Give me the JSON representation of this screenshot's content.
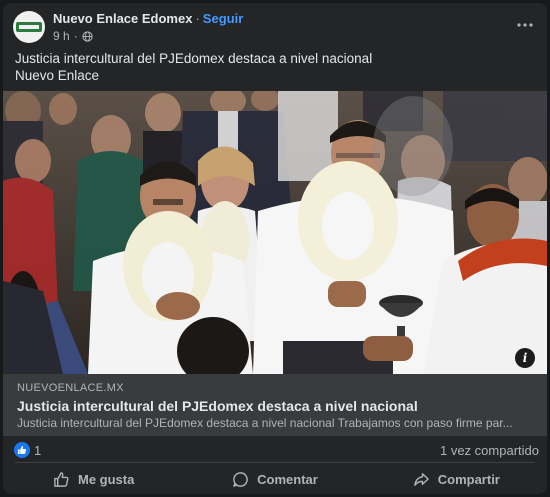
{
  "post": {
    "page_name": "Nuevo Enlace Edomex",
    "separator": "·",
    "follow_label": "Seguir",
    "time": "9 h",
    "privacy_icon": "globe-icon",
    "more_icon": "more-dots-icon",
    "text_lines": [
      "Justicia intercultural del PJEdomex destaca a nivel nacional",
      "Nuevo Enlace"
    ]
  },
  "link_preview": {
    "domain": "NUEVOENLACE.MX",
    "title": "Justicia intercultural del PJEdomex destaca a nivel nacional",
    "description": "Justicia intercultural del PJEdomex destaca a nivel nacional Trabajamos con paso firme par...",
    "info_icon": "info-icon"
  },
  "stats": {
    "reaction_icon": "like-reaction-icon",
    "likes": "1",
    "shares": "1 vez compartido"
  },
  "actions": [
    {
      "label": "Me gusta",
      "icon": "thumbs-up-icon"
    },
    {
      "label": "Comentar",
      "icon": "comment-icon"
    },
    {
      "label": "Compartir",
      "icon": "share-icon"
    }
  ],
  "colors": {
    "background": "#18191a",
    "card": "#242526",
    "link_box": "#3a3b3c",
    "accent": "#4599ff",
    "like_blue": "#1877f2",
    "text_primary": "#e4e6eb",
    "text_secondary": "#b0b3b8"
  }
}
